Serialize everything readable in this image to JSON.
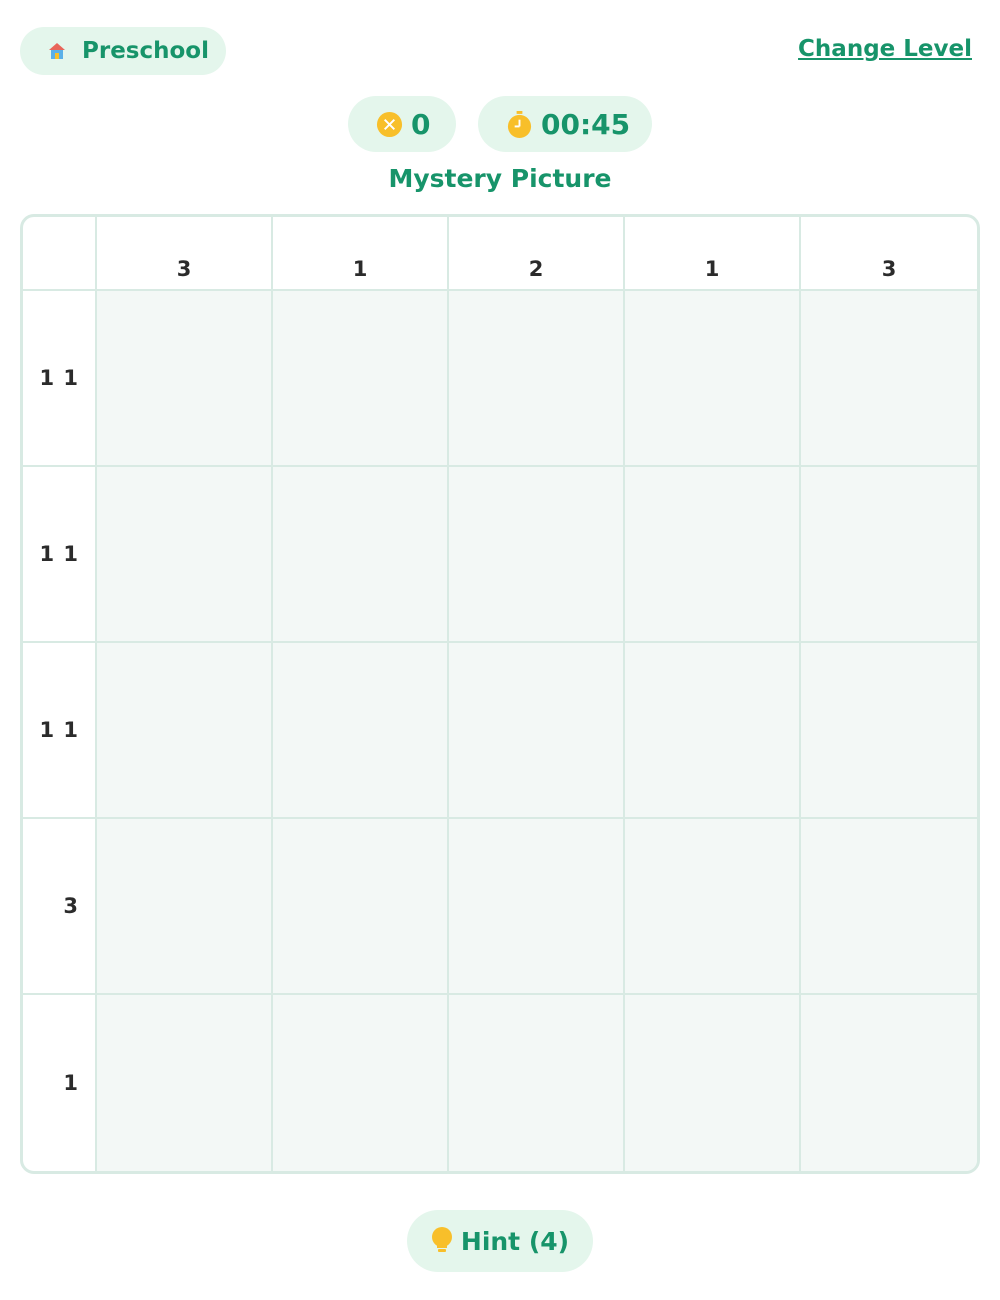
{
  "header": {
    "level_label": "Preschool",
    "level_icon": "house-icon",
    "change_level_label": "Change Level"
  },
  "stats": {
    "mistakes": "0",
    "mistakes_icon": "x-circle-icon",
    "timer": "00:45",
    "timer_icon": "stopwatch-icon"
  },
  "puzzle": {
    "title": "Mystery Picture",
    "size": 5,
    "column_clues": [
      "3",
      "1",
      "2",
      "1",
      "3"
    ],
    "row_clues": [
      "1 1",
      "1 1",
      "1 1",
      "3",
      "1"
    ],
    "cell_color": "#f3f8f6",
    "grid_line_color": "#d8eae3"
  },
  "footer": {
    "hint_label": "Hint (4)",
    "hint_icon": "lightbulb-icon"
  },
  "colors": {
    "accent": "#17946a",
    "pill_bg": "#e4f6ec",
    "icon_yellow": "#f8bf2a"
  }
}
